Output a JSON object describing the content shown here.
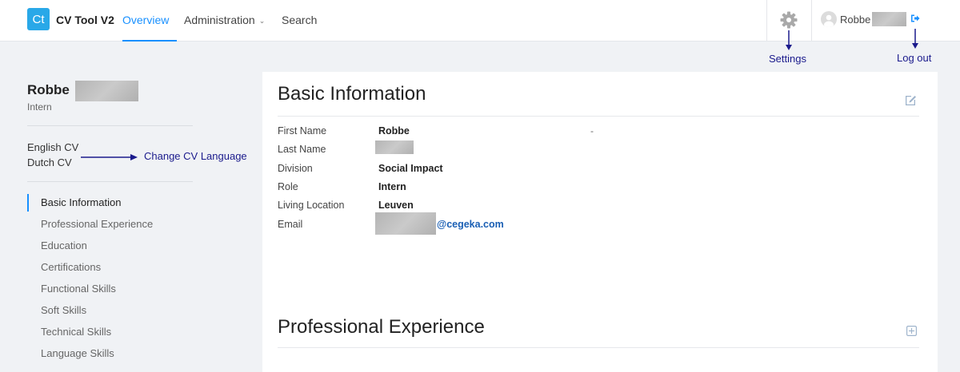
{
  "header": {
    "logo_text": "Ct",
    "app_title": "CV Tool V2",
    "nav": [
      {
        "label": "Overview",
        "active": true
      },
      {
        "label": "Administration",
        "has_dropdown": true
      },
      {
        "label": "Search"
      }
    ],
    "user_name": "Robbe",
    "accent_color": "#1890ff",
    "logo_color": "#29a8e8"
  },
  "annotations": {
    "settings": "Settings",
    "logout": "Log out",
    "change_cv_language": "Change CV Language",
    "color": "#1a1a8c"
  },
  "sidebar": {
    "person_name": "Robbe",
    "person_role": "Intern",
    "cv_languages": [
      "English CV",
      "Dutch CV"
    ],
    "sections": [
      {
        "label": "Basic Information",
        "active": true
      },
      {
        "label": "Professional Experience"
      },
      {
        "label": "Education"
      },
      {
        "label": "Certifications"
      },
      {
        "label": "Functional Skills"
      },
      {
        "label": "Soft Skills"
      },
      {
        "label": "Technical Skills"
      },
      {
        "label": "Language Skills"
      }
    ]
  },
  "basic_info": {
    "title": "Basic Information",
    "fields": [
      {
        "label": "First Name",
        "value": "Robbe"
      },
      {
        "label": "Last Name",
        "value": ""
      },
      {
        "label": "Division",
        "value": "Social Impact"
      },
      {
        "label": "Role",
        "value": "Intern"
      },
      {
        "label": "Living Location",
        "value": "Leuven"
      },
      {
        "label": "Email",
        "value": "@cegeka.com"
      }
    ],
    "extra": "-"
  },
  "professional_experience": {
    "title": "Professional Experience"
  },
  "icons": {
    "settings": "gear-icon",
    "logout": "logout-icon",
    "avatar": "user-avatar-icon",
    "edit": "edit-icon",
    "add": "add-icon",
    "dropdown": "chevron-down-icon"
  }
}
